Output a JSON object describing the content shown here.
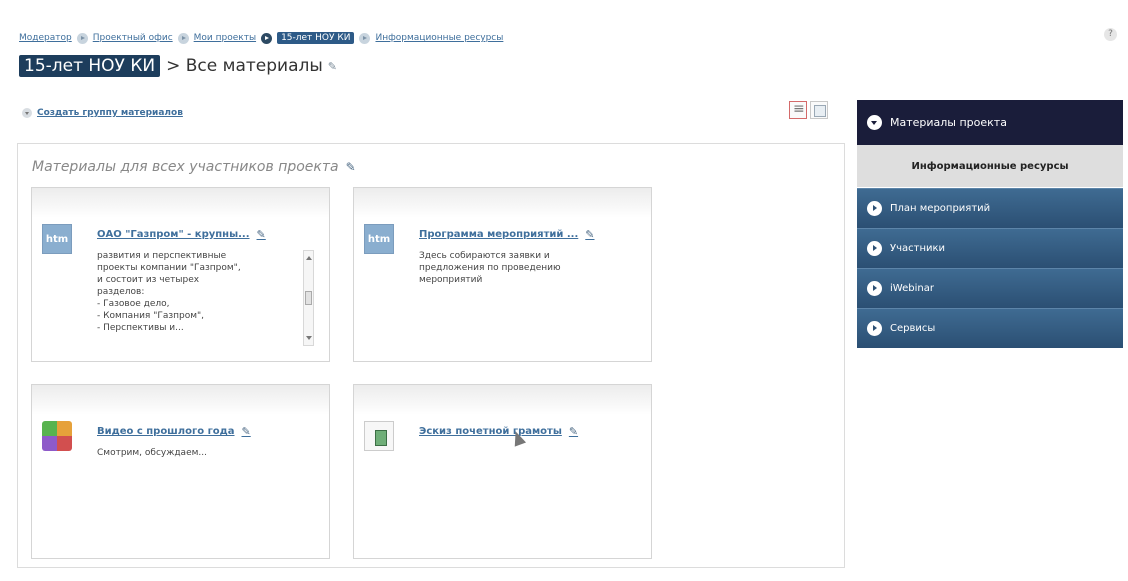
{
  "breadcrumb": {
    "items": [
      "Модератор",
      "Проектный офис",
      "Мои проекты",
      "15-лет НОУ КИ",
      "Информационные ресурсы"
    ]
  },
  "title": {
    "chip": "15-лет НОУ КИ",
    "rest": "> Все материалы"
  },
  "toolbar": {
    "create_group_label": "Создать группу материалов"
  },
  "panel": {
    "title": "Материалы для всех участников проекта",
    "cards": [
      {
        "icon_text": "htm",
        "title": "ОАО \"Газпром\" - крупны...",
        "description": "развития и перспективные\nпроекты компании \"Газпром\",\nи состоит из четырех\nразделов:\n- Газовое дело,\n- Компания \"Газпром\",\n- Перспективы и..."
      },
      {
        "icon_text": "htm",
        "title": "Программа мероприятий ...",
        "description": "Здесь собираются заявки и\nпредложения по проведению\nмероприятий"
      },
      {
        "title": "Видео с прошлого года",
        "description": "Смотрим, обсуждаем..."
      },
      {
        "title": "Эскиз почетной грамоты",
        "description": ""
      }
    ]
  },
  "sidebar": {
    "header": "Материалы проекта",
    "active_sub": "Информационные ресурсы",
    "items": [
      "План мероприятий",
      "Участники",
      "iWebinar",
      "Сервисы"
    ]
  },
  "help_label": "?",
  "colors": {
    "accent": "#2d5a87",
    "sidebar_dark": "#1a1d3a",
    "sidebar_item": "#34597e",
    "link": "#3f6f9c"
  }
}
